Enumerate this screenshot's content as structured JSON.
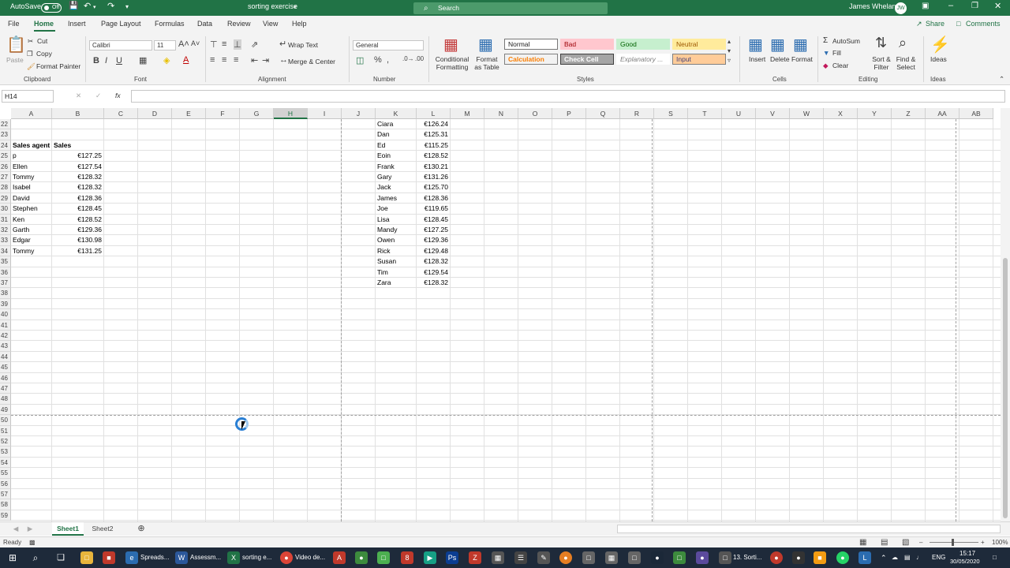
{
  "title_bar": {
    "autosave_label": "AutoSave",
    "autosave_state": "Off",
    "document_title": "sorting exercise",
    "search_placeholder": "Search",
    "user_name": "James Whelan",
    "user_initials": "JW"
  },
  "tabs": {
    "items": [
      "File",
      "Home",
      "Insert",
      "Page Layout",
      "Formulas",
      "Data",
      "Review",
      "View",
      "Help"
    ],
    "share_label": "Share",
    "comments_label": "Comments"
  },
  "ribbon": {
    "clipboard": {
      "paste": "Paste",
      "cut": "Cut",
      "copy": "Copy",
      "format_painter": "Format Painter",
      "group_label": "Clipboard"
    },
    "font": {
      "name": "Calibri",
      "size": "11",
      "bold": "B",
      "italic": "I",
      "underline": "U",
      "group_label": "Font"
    },
    "alignment": {
      "wrap_text": "Wrap Text",
      "merge_center": "Merge & Center",
      "group_label": "Alignment"
    },
    "number": {
      "format": "General",
      "group_label": "Number"
    },
    "styles": {
      "conditional": "Conditional Formatting",
      "format_as_table": "Format as Table",
      "cells": [
        "Normal",
        "Bad",
        "Good",
        "Neutral",
        "Calculation",
        "Check Cell",
        "Explanatory ...",
        "Input"
      ],
      "group_label": "Styles"
    },
    "cells": {
      "insert": "Insert",
      "delete": "Delete",
      "format": "Format",
      "group_label": "Cells"
    },
    "editing": {
      "autosum": "AutoSum",
      "fill": "Fill",
      "clear": "Clear",
      "sort_filter": "Sort & Filter",
      "find_select": "Find & Select",
      "group_label": "Editing"
    },
    "ideas": {
      "label": "Ideas",
      "group_label": "Ideas"
    }
  },
  "formula_bar": {
    "name_box": "H14",
    "formula": ""
  },
  "grid": {
    "columns": [
      "A",
      "B",
      "C",
      "D",
      "E",
      "F",
      "G",
      "H",
      "I",
      "J",
      "K",
      "L",
      "M",
      "N",
      "O",
      "P",
      "Q",
      "R",
      "S",
      "T",
      "U",
      "V",
      "W",
      "X",
      "Y",
      "Z",
      "AA",
      "AB"
    ],
    "selected_column": "H",
    "rows": [
      "22",
      "23",
      "24",
      "25",
      "26",
      "27",
      "28",
      "29",
      "30",
      "31",
      "32",
      "33",
      "34",
      "35",
      "36",
      "37",
      "38",
      "39",
      "40",
      "41",
      "42",
      "43",
      "44",
      "45",
      "46",
      "47",
      "48",
      "49",
      "50",
      "51",
      "52",
      "53",
      "54",
      "55",
      "56",
      "57",
      "58",
      "59"
    ],
    "table_left": {
      "header": [
        "Sales agent",
        "Sales"
      ],
      "rows": [
        [
          "p",
          "€127.25"
        ],
        [
          "Ellen",
          "€127.54"
        ],
        [
          "Tommy",
          "€128.32"
        ],
        [
          "Isabel",
          "€128.32"
        ],
        [
          "David",
          "€128.36"
        ],
        [
          "Stephen",
          "€128.45"
        ],
        [
          "Ken",
          "€128.52"
        ],
        [
          "Garth",
          "€129.36"
        ],
        [
          "Edgar",
          "€130.98"
        ],
        [
          "Tommy",
          "€131.25"
        ]
      ]
    },
    "table_right": {
      "rows": [
        [
          "Ciara",
          "€126.24"
        ],
        [
          "Dan",
          "€125.31"
        ],
        [
          "Ed",
          "€115.25"
        ],
        [
          "Eoin",
          "€128.52"
        ],
        [
          "Frank",
          "€130.21"
        ],
        [
          "Gary",
          "€131.26"
        ],
        [
          "Jack",
          "€125.70"
        ],
        [
          "James",
          "€128.36"
        ],
        [
          "Joe",
          "€119.65"
        ],
        [
          "Lisa",
          "€128.45"
        ],
        [
          "Mandy",
          "€127.25"
        ],
        [
          "Owen",
          "€129.36"
        ],
        [
          "Rick",
          "€129.48"
        ],
        [
          "Susan",
          "€128.32"
        ],
        [
          "Tim",
          "€129.54"
        ],
        [
          "Zara",
          "€128.32"
        ]
      ]
    }
  },
  "sheets": {
    "tabs": [
      "Sheet1",
      "Sheet2"
    ],
    "active": "Sheet1"
  },
  "status_bar": {
    "status": "Ready",
    "zoom": "100%"
  },
  "taskbar": {
    "items": [
      "Spreads...",
      "Assessm...",
      "sorting e...",
      "Video de...",
      "13. Sorti..."
    ],
    "lang": "ENG",
    "time": "15:17",
    "date": "30/05/2020"
  },
  "colors": {
    "accent": "#217346",
    "bad_bg": "#ffc7ce",
    "bad_fg": "#9c0006",
    "good_bg": "#c6efce",
    "good_fg": "#006100",
    "neutral_bg": "#ffeb9c",
    "neutral_fg": "#9c5700",
    "check_bg": "#a5a5a5",
    "input_bg": "#ffcc99"
  }
}
